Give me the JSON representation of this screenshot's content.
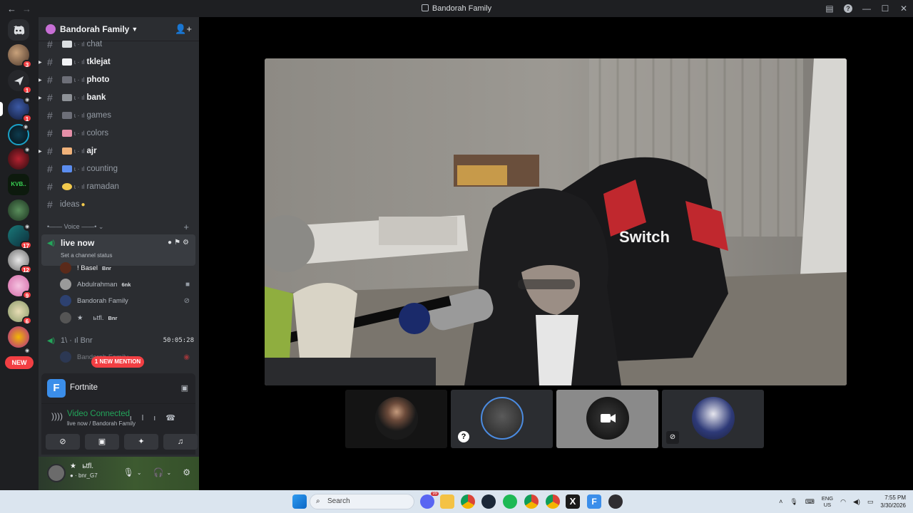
{
  "window": {
    "title": "Bandorah Family",
    "back": "←",
    "forward": "→"
  },
  "guilds": {
    "badges": [
      "3",
      "1",
      "1",
      "17",
      "12",
      "9",
      "6"
    ],
    "kvb_label": "KVB..",
    "new_label": "NEW"
  },
  "server": {
    "name": "Bandorah Family"
  },
  "channels": [
    {
      "name": "chat",
      "unread": false
    },
    {
      "name": "tklejat",
      "unread": true
    },
    {
      "name": "photo",
      "unread": true
    },
    {
      "name": "bank",
      "unread": true
    },
    {
      "name": "games",
      "unread": false
    },
    {
      "name": "colors",
      "unread": false
    },
    {
      "name": "ajr",
      "unread": true
    },
    {
      "name": "counting",
      "unread": false
    },
    {
      "name": "ramadan",
      "unread": false
    },
    {
      "name": "ideas",
      "unread": false
    }
  ],
  "voice_category": "Voice",
  "voice_channel": {
    "name": "live now",
    "status_placeholder": "Set a channel status"
  },
  "voice_users": [
    {
      "name": "! Basel",
      "tag": "Bnr"
    },
    {
      "name": "Abdulrahman",
      "tag": "6nk"
    },
    {
      "name": "Bandorah Family",
      "tag": ""
    },
    {
      "name": "ьtfl.",
      "tag": "Bnr"
    }
  ],
  "voice_channel_2": {
    "name": "Bnr",
    "prefix": "1\\",
    "timer": "50:05:28",
    "user": "Bandorah Family"
  },
  "mention_pill": "1 NEW MENTION",
  "activity": {
    "name": "Fortnite"
  },
  "rtc": {
    "status": "Video Connected",
    "location": "live now / Bandorah Family"
  },
  "user": {
    "display": "ьtfl.",
    "sub": "bnr_G7"
  },
  "taskbar": {
    "search_placeholder": "Search",
    "lang_top": "ENG",
    "lang_bottom": "US",
    "time": "7:55 PM",
    "date": "3/30/2026",
    "discord_badge": "99"
  },
  "video": {
    "chair_text": "Switch"
  }
}
